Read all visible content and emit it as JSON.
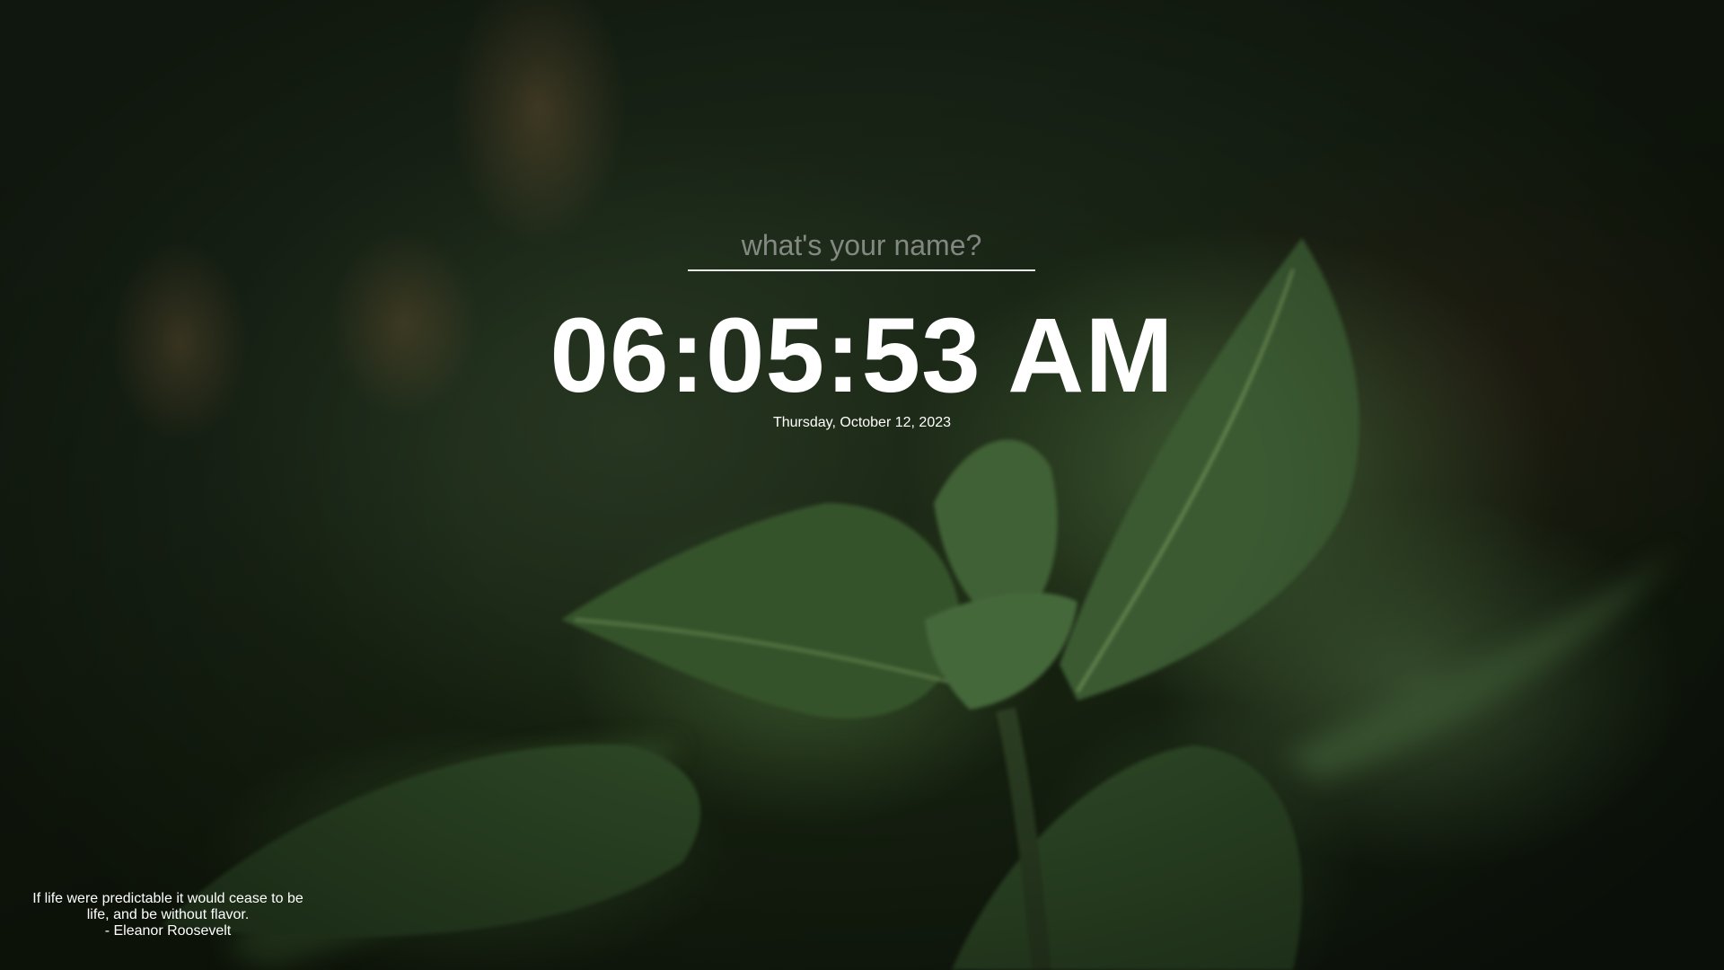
{
  "name_prompt": {
    "placeholder": "what's your name?"
  },
  "clock": {
    "time": "06:05:53 AM",
    "date": "Thursday, October 12, 2023"
  },
  "quote": {
    "text": "If life were predictable it would cease to be life, and be without flavor.",
    "author": "- Eleanor Roosevelt"
  },
  "background": {
    "subject": "blurred green mint leaves",
    "base_color": "#16210f"
  }
}
